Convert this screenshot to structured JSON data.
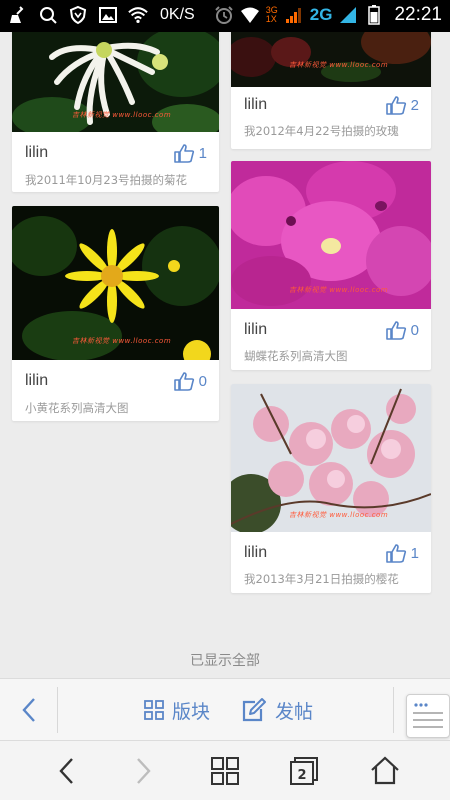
{
  "status_bar": {
    "net_speed": "0K/S",
    "net_type_small_top": "3G",
    "net_type_small_bottom": "1X",
    "net_type": "2G",
    "time": "22:21",
    "icons": [
      "broom-icon",
      "search-icon",
      "shield-icon",
      "image-icon",
      "wifi-icon",
      "alarm-icon",
      "wifi-icon",
      "signal-icon",
      "signal-icon",
      "battery-icon"
    ]
  },
  "feed": {
    "cards": [
      {
        "user": "lilin",
        "likes": "1",
        "caption": "我2011年10月23号拍摄的菊花",
        "photo": "white-chrysanthemum"
      },
      {
        "user": "lilin",
        "likes": "2",
        "caption": "我2012年4月22号拍摄的玫瑰",
        "photo": "rose"
      },
      {
        "user": "lilin",
        "likes": "0",
        "caption": "小黄花系列高清大图",
        "photo": "yellow-daisy"
      },
      {
        "user": "lilin",
        "likes": "0",
        "caption": "蝴蝶花系列高清大图",
        "photo": "pink-orchid"
      },
      {
        "user": "lilin",
        "likes": "1",
        "caption": "我2013年3月21日拍摄的樱花",
        "photo": "cherry-blossom"
      }
    ],
    "watermark": "吉林新视觉 www.llooc.com",
    "end_text": "已显示全部"
  },
  "app_bar": {
    "blocks_label": "版块",
    "post_label": "发帖"
  },
  "colors": {
    "accent": "#5a86c8",
    "background": "#ececec",
    "net_orange": "#ff6a00",
    "net_blue": "#33b5e5"
  }
}
